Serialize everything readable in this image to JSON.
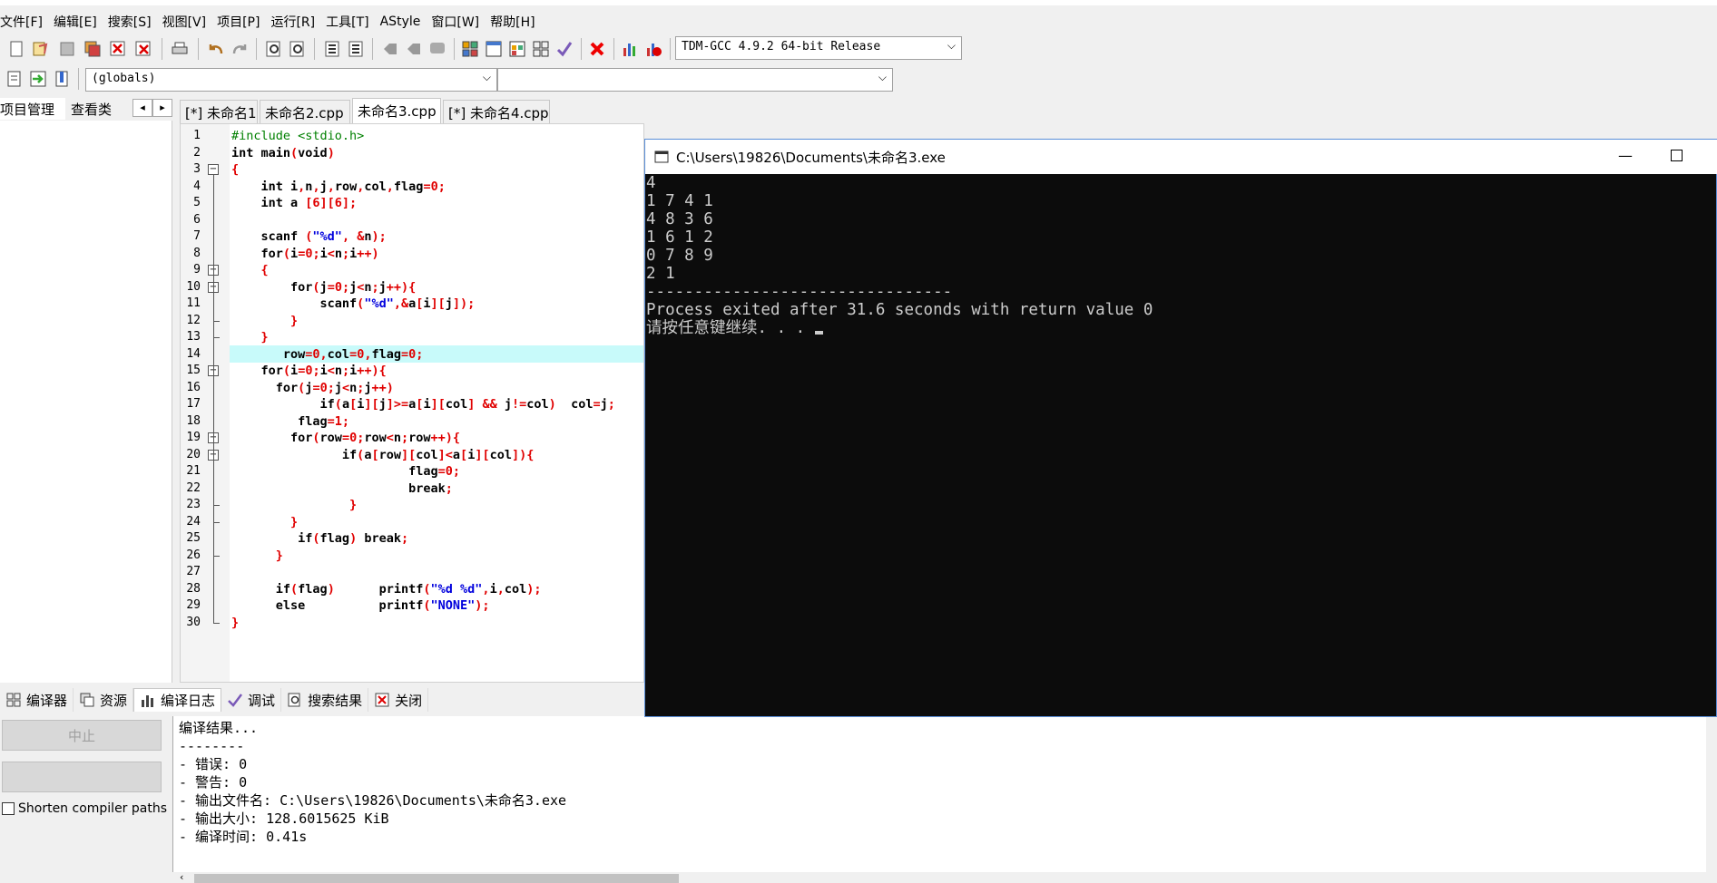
{
  "menu": [
    "文件[F]",
    "编辑[E]",
    "搜索[S]",
    "视图[V]",
    "项目[P]",
    "运行[R]",
    "工具[T]",
    "AStyle",
    "窗口[W]",
    "帮助[H]"
  ],
  "toolbar": {
    "compiler_select": "TDM-GCC 4.9.2 64-bit Release",
    "globals_select": "(globals)",
    "func_select": ""
  },
  "left_tabs": {
    "project": "项目管理",
    "classes": "查看类"
  },
  "file_tabs": [
    "[*] 未命名1",
    "未命名2.cpp",
    "未命名3.cpp",
    "[*] 未命名4.cpp"
  ],
  "active_file_tab": 2,
  "editor": {
    "line_numbers": [
      "1",
      "2",
      "3",
      "4",
      "5",
      "6",
      "7",
      "8",
      "9",
      "10",
      "11",
      "12",
      "13",
      "14",
      "15",
      "16",
      "17",
      "18",
      "19",
      "20",
      "21",
      "22",
      "23",
      "24",
      "25",
      "26",
      "27",
      "28",
      "29",
      "30"
    ],
    "highlighted_line": 14
  },
  "bottom_tabs": [
    "编译器",
    "资源",
    "编译日志",
    "调试",
    "搜索结果",
    "关闭"
  ],
  "bottom_left": {
    "abort_button": "中止",
    "shorten_label": "Shorten compiler paths"
  },
  "compile_log": [
    "编译结果...",
    "--------",
    "- 错误: 0",
    "- 警告: 0",
    "- 输出文件名: C:\\Users\\19826\\Documents\\未命名3.exe",
    "- 输出大小: 128.6015625 KiB",
    "- 编译时间: 0.41s"
  ],
  "console": {
    "title": "C:\\Users\\19826\\Documents\\未命名3.exe",
    "lines": [
      "4",
      "1 7 4 1",
      "4 8 3 6",
      "1 6 1 2",
      "0 7 8 9",
      "2 1",
      "--------------------------------",
      "Process exited after 31.6 seconds with return value 0",
      "请按任意键继续. . . "
    ]
  }
}
